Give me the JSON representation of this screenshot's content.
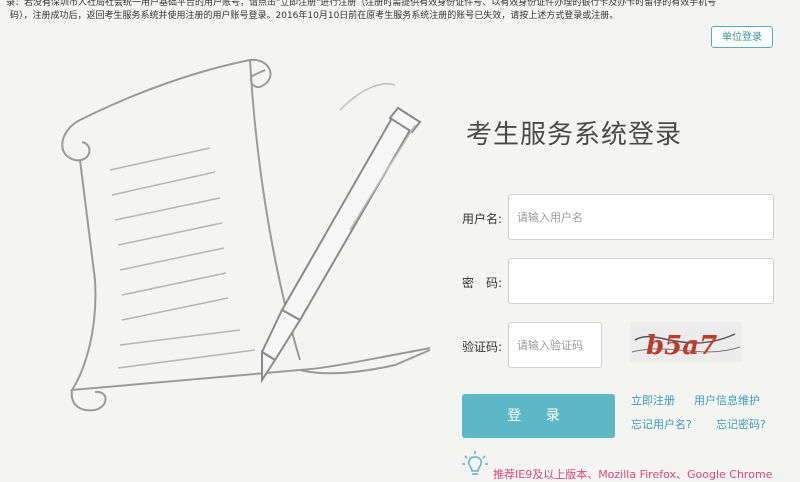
{
  "notice": {
    "line1": "录：若没有深圳市人社局社会统一用户基础平台的用户账号，请点击\"立即注册\"进行注册（注册时需提供有效身份证件号、以有效身份证件办理的银行卡及办卡时留存的有效手机号",
    "line2": "码），注册成功后，返回考生服务系统并使用注册的用户账号登录。2016年10月10日前在原考生服务系统注册的账号已失效，请按上述方式登录或注册。"
  },
  "unit_login_label": "单位登录",
  "title": "考生服务系统登录",
  "form": {
    "username_label": "用户名:",
    "username_placeholder": "请输入用户名",
    "password_label": "密　码:",
    "captcha_label": "验证码:",
    "captcha_placeholder": "请输入验证码",
    "captcha_text": "b5a7",
    "login_label": "登 录"
  },
  "links": {
    "register": "立即注册",
    "maintain": "用户信息维护",
    "forgot_username": "忘记用户名?",
    "forgot_password": "忘记密码?"
  },
  "tip": "推荐IE9及以上版本、Mozilla Firefox、Google Chrome",
  "colors": {
    "accent": "#5db8c6",
    "link": "#3a9ab4",
    "tip": "#e0467a"
  }
}
